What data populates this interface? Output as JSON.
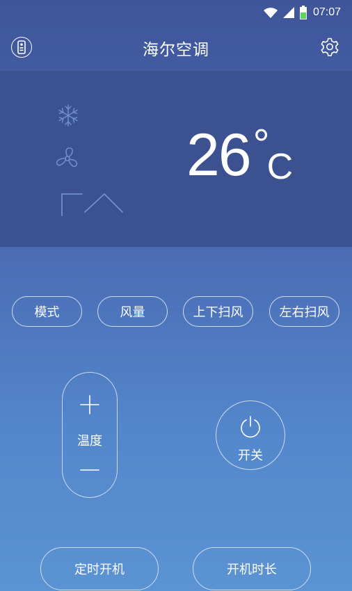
{
  "status_bar": {
    "time": "07:07",
    "icons": [
      "wifi-icon",
      "signal-icon",
      "battery-icon"
    ],
    "battery_color": "#5fd35f"
  },
  "header": {
    "title": "海尔空调",
    "left_icon": "remote-icon",
    "right_icon": "gear-icon"
  },
  "display": {
    "temperature": "26",
    "degree_symbol": "°",
    "unit": "C",
    "indicator_icons": [
      "snowflake-icon",
      "fan-icon",
      "swing-icon"
    ],
    "panel_color": "#3c5190"
  },
  "modes": {
    "mode": "模式",
    "fan_speed": "风量",
    "vertical_swing": "上下扫风",
    "horizontal_swing": "左右扫风"
  },
  "controls": {
    "temp_label": "温度",
    "power_label": "开关"
  },
  "bottom": {
    "timer_on": "定时开机",
    "on_duration": "开机时长"
  }
}
